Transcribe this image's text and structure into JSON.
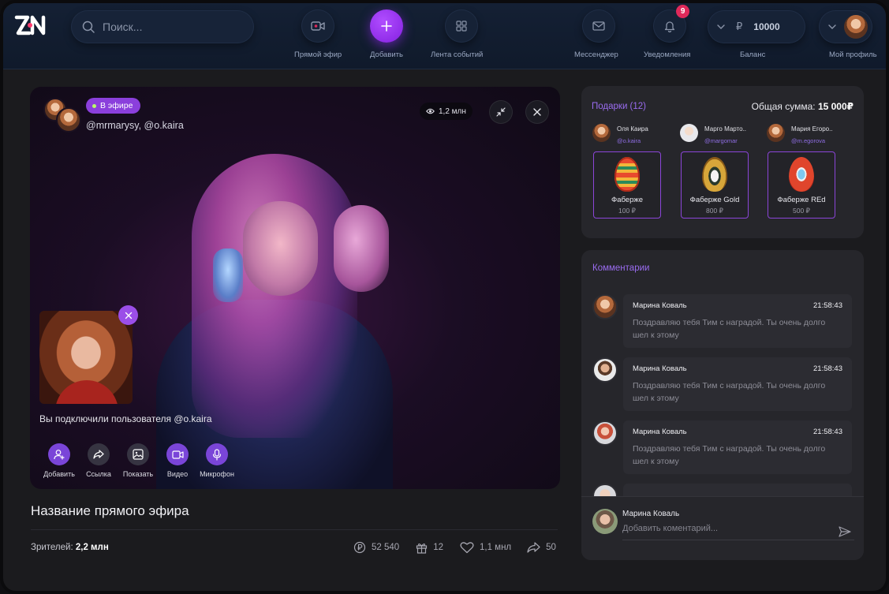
{
  "app": {
    "logo_text": "ZN"
  },
  "header": {
    "search_placeholder": "Поиск...",
    "nav": {
      "live": "Прямой эфир",
      "add": "Добавить",
      "feed": "Лента событий",
      "messenger": "Мессенджер",
      "notifications": "Уведомления",
      "notifications_count": "9",
      "balance": "Баланс",
      "profile": "Мой профиль"
    },
    "balance_currency": "₽",
    "balance_amount": "10000"
  },
  "stream": {
    "live_badge": "В эфире",
    "users": "@mrmarysy, @o.kaira",
    "views": "1,2 млн",
    "connected_message": "Вы подключили пользователя @o.kaira",
    "controls": [
      {
        "label": "Добавить"
      },
      {
        "label": "Ссылка"
      },
      {
        "label": "Показать"
      },
      {
        "label": "Видео"
      },
      {
        "label": "Микрофон"
      }
    ],
    "title": "Название прямого эфира",
    "viewers_label": "Зрителей:",
    "viewers_value": "2,2 млн",
    "stats": {
      "coins": "52 540",
      "gifts": "12",
      "likes": "1,1 мнл",
      "shares": "50"
    }
  },
  "gifts": {
    "title": "Подарки (12)",
    "total_label": "Общая сумма:",
    "total_value": "15 000₽",
    "items": [
      {
        "donor": "Оля Каира",
        "handle": "@o.kaira",
        "gift": "Фаберже",
        "price": "100 ₽"
      },
      {
        "donor": "Марго Марто..",
        "handle": "@margomar",
        "gift": "Фаберже Gold",
        "price": "800 ₽"
      },
      {
        "donor": "Мария Егоро..",
        "handle": "@m.egorova",
        "gift": "Фаберже REd",
        "price": "500 ₽"
      }
    ]
  },
  "comments": {
    "title": "Комментарии",
    "items": [
      {
        "name": "Марина Коваль",
        "time": "21:58:43",
        "text": "Поздравляю тебя Тим с наградой. Ты очень долго шел к этому"
      },
      {
        "name": "Марина Коваль",
        "time": "21:58:43",
        "text": "Поздравляю тебя Тим с наградой. Ты очень долго шел к этому"
      },
      {
        "name": "Марина Коваль",
        "time": "21:58:43",
        "text": "Поздравляю тебя Тим с наградой. Ты очень долго шел к этому"
      }
    ],
    "composer_name": "Марина Коваль",
    "composer_placeholder": "Добавить коментарий..."
  },
  "colors": {
    "accent": "#8b3fdc",
    "header_bg": "#142034",
    "panel_bg": "#26262b",
    "badge": "#e0295a"
  }
}
